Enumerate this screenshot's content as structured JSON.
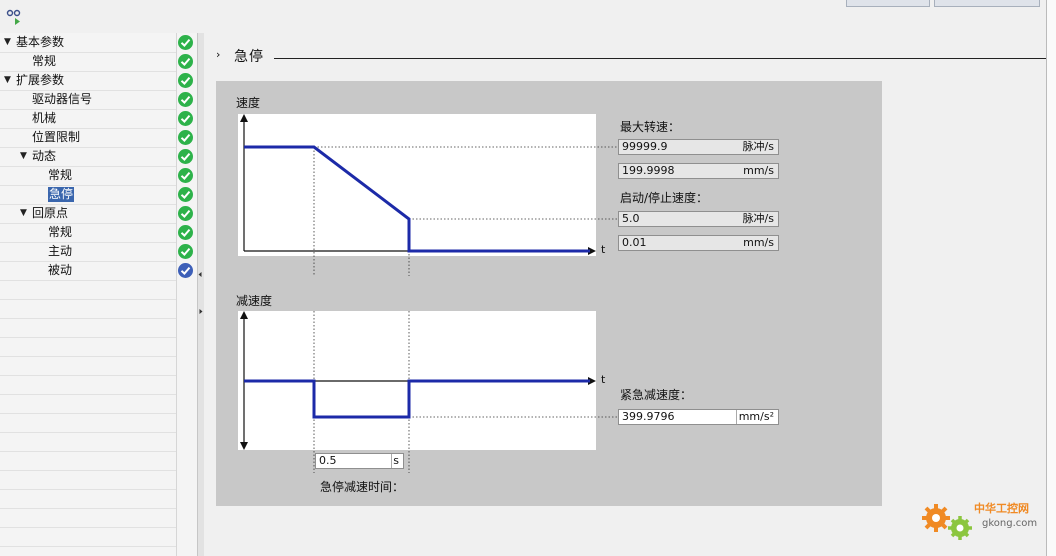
{
  "tree": {
    "items": [
      {
        "label": "基本参数",
        "level": 0,
        "expanded": true,
        "status": "ok"
      },
      {
        "label": "常规",
        "level": 1,
        "status": "ok"
      },
      {
        "label": "扩展参数",
        "level": 0,
        "expanded": true,
        "status": "ok"
      },
      {
        "label": "驱动器信号",
        "level": 1,
        "status": "ok"
      },
      {
        "label": "机械",
        "level": 1,
        "status": "ok"
      },
      {
        "label": "位置限制",
        "level": 1,
        "status": "ok"
      },
      {
        "label": "动态",
        "level": 1,
        "expanded": true,
        "status": "ok"
      },
      {
        "label": "常规",
        "level": 2,
        "status": "ok"
      },
      {
        "label": "急停",
        "level": 2,
        "selected": true,
        "status": "ok"
      },
      {
        "label": "回原点",
        "level": 1,
        "expanded": true,
        "status": "ok"
      },
      {
        "label": "常规",
        "level": 2,
        "status": "ok"
      },
      {
        "label": "主动",
        "level": 2,
        "status": "ok"
      },
      {
        "label": "被动",
        "level": 2,
        "status": "info"
      }
    ]
  },
  "section": {
    "title": "急停"
  },
  "speed_chart": {
    "title": "速度",
    "axis_t": "t"
  },
  "decel_chart": {
    "title": "减速度",
    "axis_t": "t"
  },
  "fields": {
    "max_speed_label": "最大转速：",
    "max_speed_pulse": {
      "value": "99999.9",
      "unit": "脉冲/s"
    },
    "max_speed_mm": {
      "value": "199.9998",
      "unit": "mm/s"
    },
    "startstop_label": "启动/停止速度：",
    "startstop_pulse": {
      "value": "5.0",
      "unit": "脉冲/s"
    },
    "startstop_mm": {
      "value": "0.01",
      "unit": "mm/s"
    },
    "emerg_decel_label": "紧急减速度：",
    "emerg_decel": {
      "value": "399.9796",
      "unit": "mm/s²"
    },
    "stop_time": {
      "value": "0.5",
      "unit": "s"
    },
    "stop_time_label": "急停减速时间："
  },
  "watermark": {
    "brand": "中华工控网",
    "site": "gkong.com"
  },
  "colors": {
    "ok": "#2db24a",
    "info": "#3d5fb8",
    "curve": "#1c2aa8",
    "selection": "#3a66ad"
  }
}
